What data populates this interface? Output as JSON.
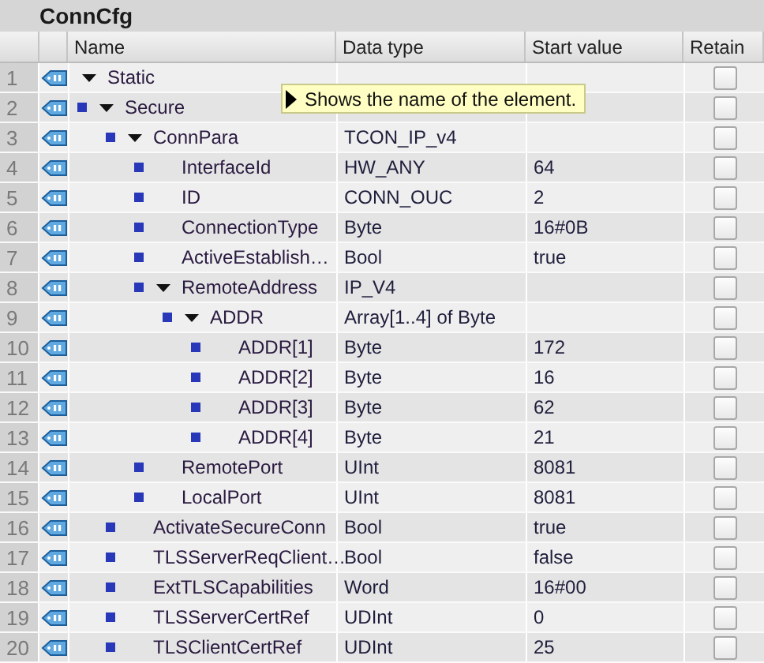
{
  "title": "ConnCfg",
  "columns": [
    "Name",
    "Data type",
    "Start value",
    "Retain"
  ],
  "members": [
    {
      "no": "1",
      "name": "Static",
      "retain": false,
      "expanded": true,
      "children": [
        {
          "no": "2",
          "name": "Secure",
          "retain": false,
          "expanded": true,
          "children": [
            {
              "no": "3",
              "name": "ConnPara",
              "data_type": "TCON_IP_v4",
              "retain": false,
              "expanded": true,
              "children": [
                {
                  "no": "4",
                  "name": "InterfaceId",
                  "data_type": "HW_ANY",
                  "start_value": "64",
                  "retain": false
                },
                {
                  "no": "5",
                  "name": "ID",
                  "data_type": "CONN_OUC",
                  "start_value": "2",
                  "retain": false
                },
                {
                  "no": "6",
                  "name": "ConnectionType",
                  "data_type": "Byte",
                  "start_value": "16#0B",
                  "retain": false
                },
                {
                  "no": "7",
                  "name": "ActiveEstablish…",
                  "data_type": "Bool",
                  "start_value": "true",
                  "retain": false
                },
                {
                  "no": "8",
                  "name": "RemoteAddress",
                  "data_type": "IP_V4",
                  "retain": false,
                  "expanded": true,
                  "children": [
                    {
                      "no": "9",
                      "name": "ADDR",
                      "data_type": "Array[1..4] of Byte",
                      "retain": false,
                      "expanded": true,
                      "children": [
                        {
                          "no": "10",
                          "name": "ADDR[1]",
                          "data_type": "Byte",
                          "start_value": "172",
                          "retain": false
                        },
                        {
                          "no": "11",
                          "name": "ADDR[2]",
                          "data_type": "Byte",
                          "start_value": "16",
                          "retain": false
                        },
                        {
                          "no": "12",
                          "name": "ADDR[3]",
                          "data_type": "Byte",
                          "start_value": "62",
                          "retain": false
                        },
                        {
                          "no": "13",
                          "name": "ADDR[4]",
                          "data_type": "Byte",
                          "start_value": "21",
                          "retain": false
                        }
                      ]
                    }
                  ]
                },
                {
                  "no": "14",
                  "name": "RemotePort",
                  "data_type": "UInt",
                  "start_value": "8081",
                  "retain": false
                },
                {
                  "no": "15",
                  "name": "LocalPort",
                  "data_type": "UInt",
                  "start_value": "8081",
                  "retain": false
                }
              ]
            },
            {
              "no": "16",
              "name": "ActivateSecureConn",
              "data_type": "Bool",
              "start_value": "true",
              "retain": false
            },
            {
              "no": "17",
              "name": "TLSServerReqClient…",
              "data_type": "Bool",
              "start_value": "false",
              "retain": false
            },
            {
              "no": "18",
              "name": "ExtTLSCapabilities",
              "data_type": "Word",
              "start_value": "16#00",
              "retain": false
            },
            {
              "no": "19",
              "name": "TLSServerCertRef",
              "data_type": "UDInt",
              "start_value": "0",
              "retain": false
            },
            {
              "no": "20",
              "name": "TLSClientCertRef",
              "data_type": "UDInt",
              "start_value": "25",
              "retain": false
            }
          ]
        }
      ]
    }
  ],
  "tooltip": "Shows the name of the element."
}
